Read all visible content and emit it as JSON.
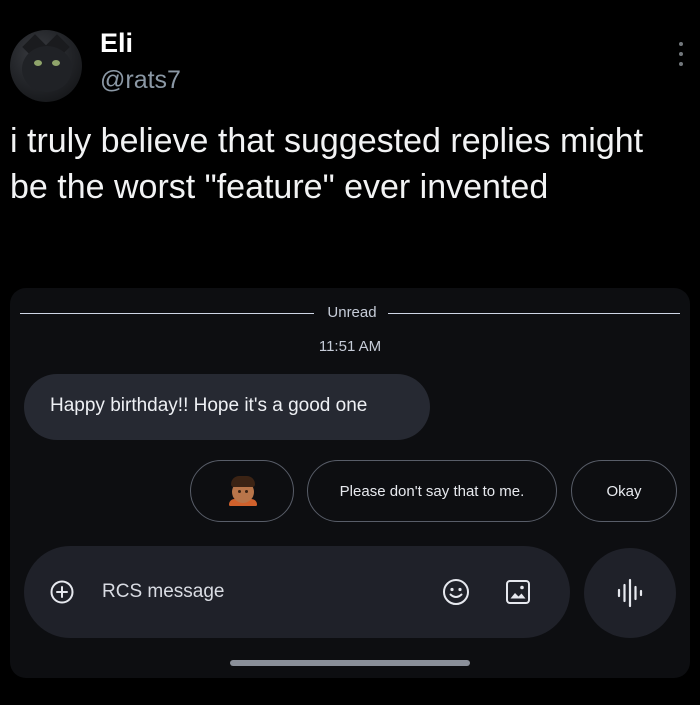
{
  "tweet": {
    "display_name": "Eli",
    "handle": "@rats7",
    "text": "i truly believe that suggested replies might be the worst \"feature\" ever invented",
    "avatar_icon": "cat-avatar"
  },
  "messages_app": {
    "divider_label": "Unread",
    "timestamp": "11:51 AM",
    "incoming_message": "Happy birthday!! Hope it's a good one",
    "suggested_replies": [
      {
        "type": "emoji",
        "icon": "man-emoji"
      },
      {
        "type": "text",
        "label": "Please don't say that to me."
      },
      {
        "type": "text",
        "label": "Okay"
      }
    ],
    "compose": {
      "placeholder": "RCS message",
      "add_icon": "plus-circle-icon",
      "emoji_icon": "smiley-icon",
      "image_icon": "image-icon",
      "voice_icon": "voice-waveform-icon"
    }
  },
  "colors": {
    "background": "#000000",
    "handle_gray": "#8b98a5",
    "app_background": "#0d0e11",
    "bubble": "#262932",
    "compose_bar": "#1f2129"
  }
}
